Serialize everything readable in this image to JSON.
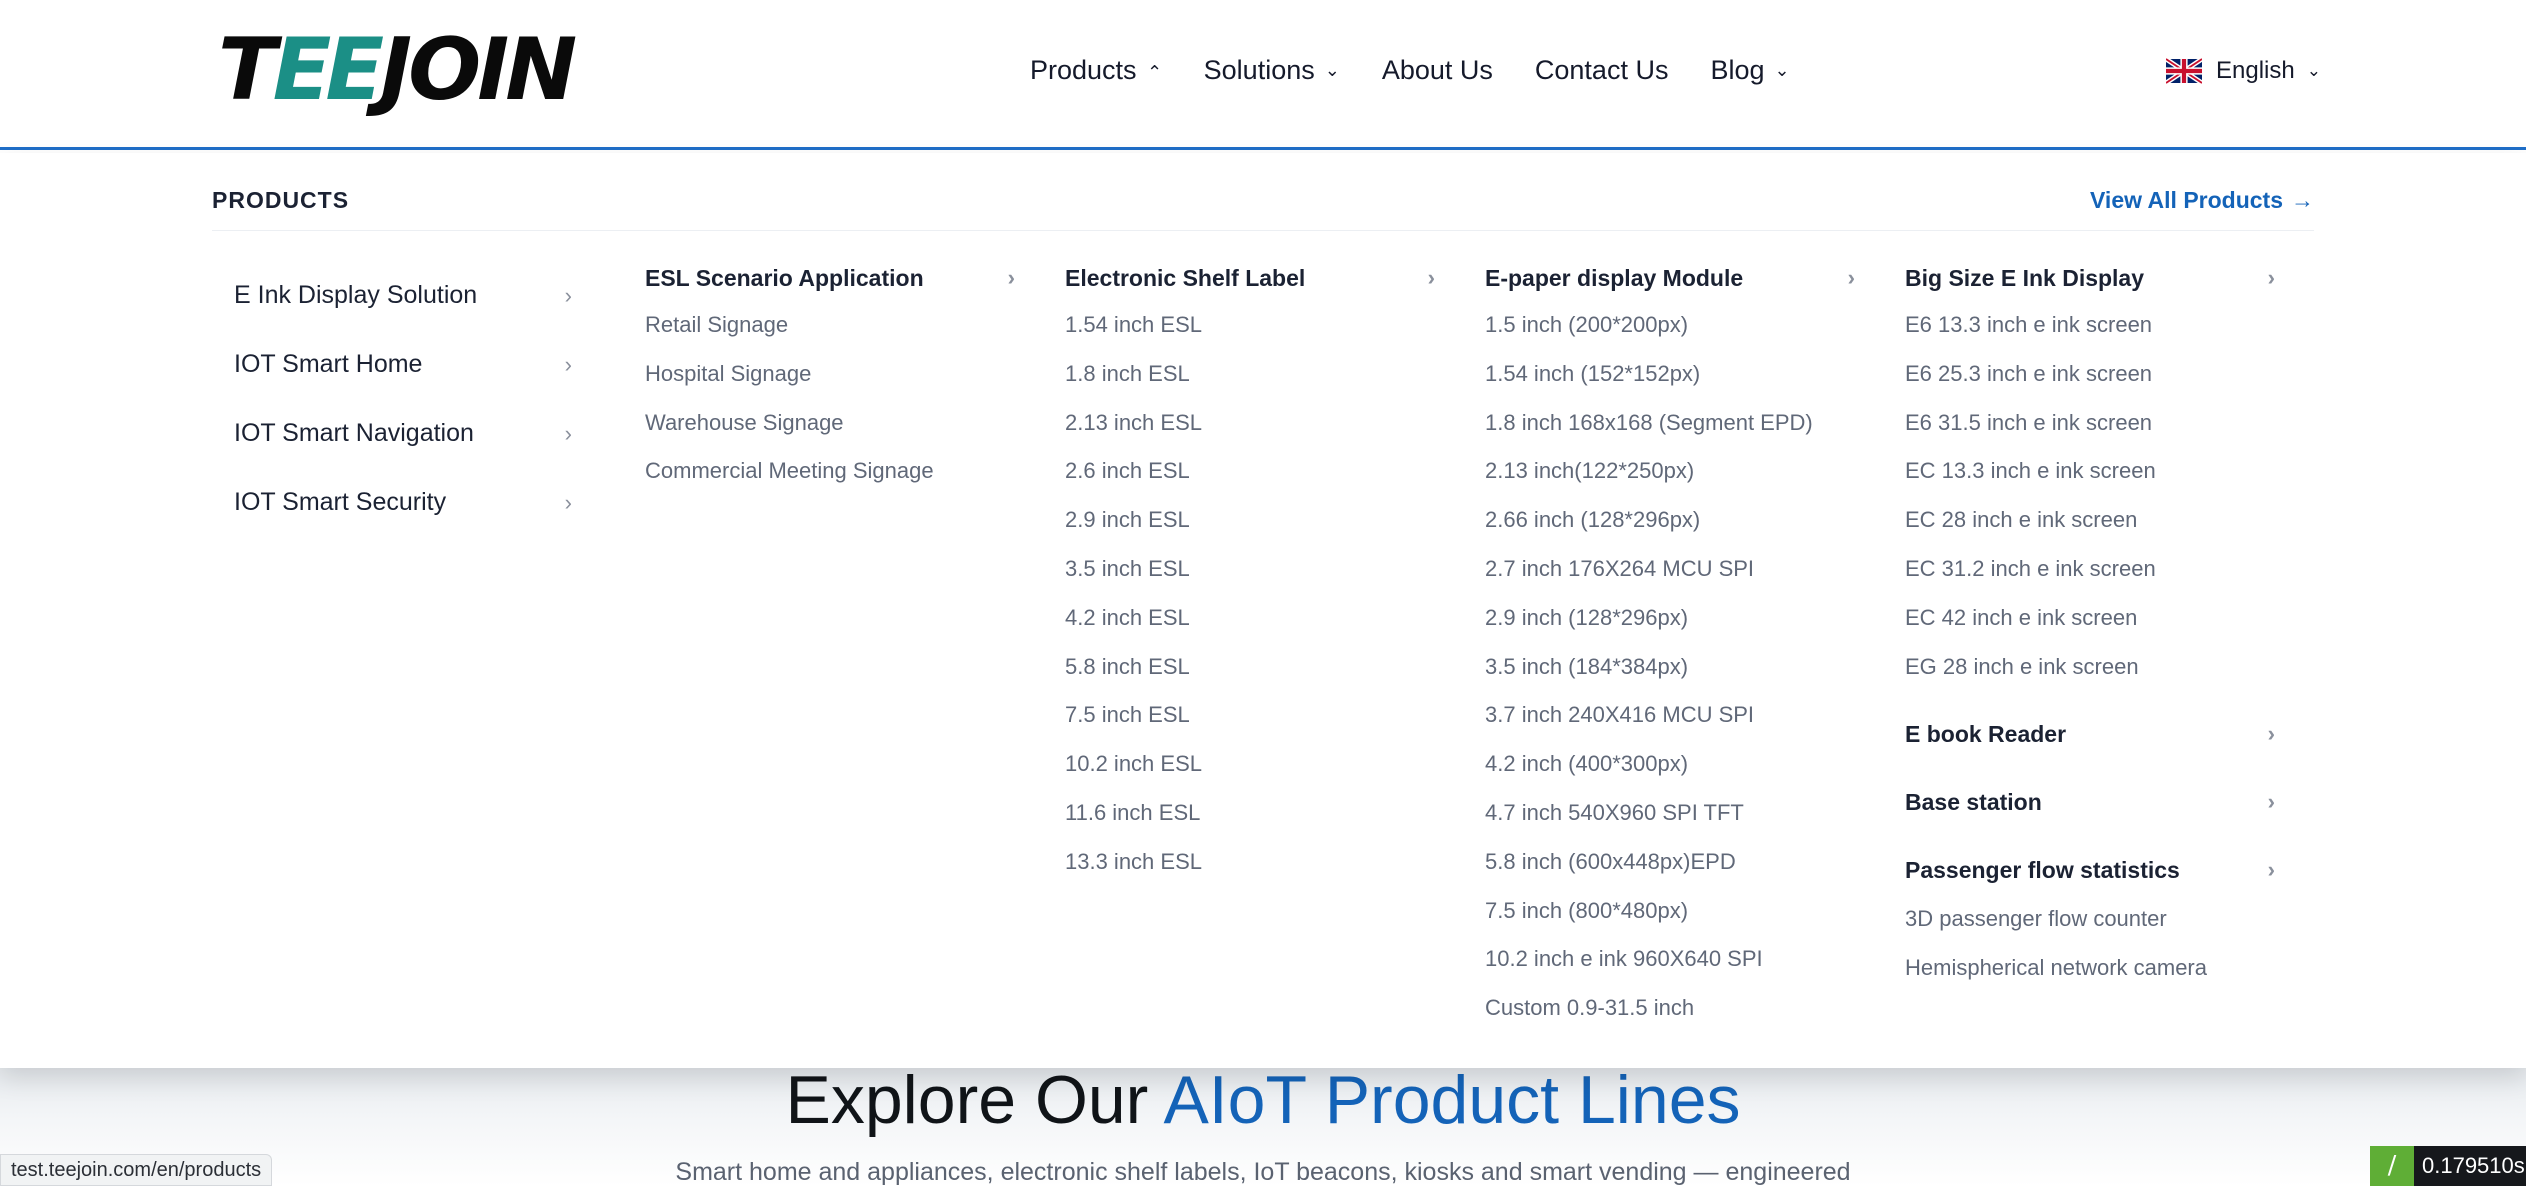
{
  "header": {
    "logo": {
      "part1": "T",
      "part2": "EE",
      "part3": "JOIN"
    },
    "nav": [
      {
        "label": "Products",
        "open": true
      },
      {
        "label": "Solutions",
        "open": false
      },
      {
        "label": "About Us"
      },
      {
        "label": "Contact Us"
      },
      {
        "label": "Blog",
        "open": false
      }
    ],
    "language": "English",
    "language_flag_icon": "uk-flag-icon"
  },
  "mega_menu": {
    "title": "PRODUCTS",
    "view_all": "View All Products",
    "categories": [
      "E Ink Display Solution",
      "IOT Smart Home",
      "IOT Smart Navigation",
      "IOT Smart Security"
    ],
    "esl_scenario": {
      "title": "ESL Scenario Application",
      "items": [
        "Retail Signage",
        "Hospital Signage",
        "Warehouse Signage",
        "Commercial Meeting Signage"
      ]
    },
    "esl": {
      "title": "Electronic Shelf Label",
      "items": [
        "1.54 inch ESL",
        "1.8 inch ESL",
        "2.13 inch ESL",
        "2.6 inch ESL",
        "2.9 inch ESL",
        "3.5 inch ESL",
        "4.2 inch ESL",
        "5.8 inch ESL",
        "7.5 inch ESL",
        "10.2 inch ESL",
        "11.6 inch ESL",
        "13.3 inch ESL"
      ]
    },
    "epaper": {
      "title": "E-paper display Module",
      "items": [
        "1.5 inch (200*200px)",
        "1.54 inch (152*152px)",
        "1.8 inch 168x168 (Segment EPD)",
        "2.13 inch(122*250px)",
        "2.66 inch (128*296px)",
        "2.7 inch 176X264 MCU SPI",
        "2.9 inch (128*296px)",
        "3.5 inch (184*384px)",
        "3.7 inch 240X416 MCU SPI",
        "4.2 inch (400*300px)",
        "4.7 inch 540X960 SPI TFT",
        "5.8 inch (600x448px)EPD",
        "7.5 inch (800*480px)",
        "10.2 inch e ink 960X640 SPI",
        "Custom 0.9-31.5 inch"
      ]
    },
    "big_size": {
      "title": "Big Size E Ink Display",
      "items": [
        "E6 13.3 inch e ink screen",
        "E6 25.3 inch e ink screen",
        "E6 31.5 inch e ink screen",
        "EC 13.3 inch e ink screen",
        "EC 28 inch e ink screen",
        "EC 31.2 inch e ink screen",
        "EC 42 inch e ink screen",
        "EG 28 inch e ink screen"
      ]
    },
    "ebook": {
      "title": "E book Reader"
    },
    "base_station": {
      "title": "Base station"
    },
    "passenger": {
      "title": "Passenger flow statistics",
      "items": [
        "3D passenger flow counter",
        "Hemispherical network camera"
      ]
    }
  },
  "hero": {
    "title_plain": "Explore Our",
    "title_accent": "AIoT Product Lines",
    "subtitle": "Smart home and appliances, electronic shelf labels, IoT beacons, kiosks and smart vending — engineered"
  },
  "status_bar": {
    "url": "test.teejoin.com/en/products"
  },
  "timer": {
    "value": "0.179510s"
  },
  "colors": {
    "accent": "#1463b8",
    "brand_teal": "#1b8f86",
    "nav_border": "#1f6ec8"
  }
}
